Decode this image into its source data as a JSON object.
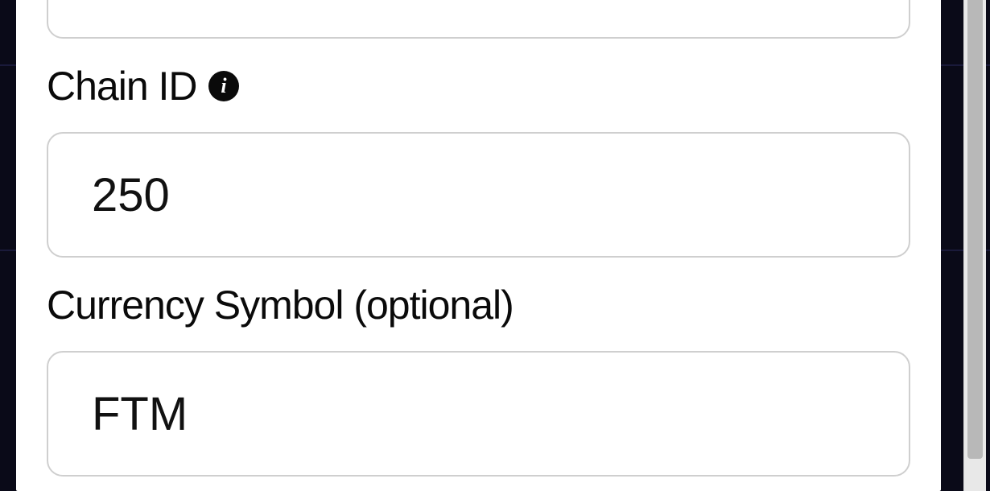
{
  "form": {
    "prev_field": {
      "value": ""
    },
    "chain_id": {
      "label": "Chain ID",
      "value": "250",
      "info_glyph": "i"
    },
    "currency_symbol": {
      "label": "Currency Symbol (optional)",
      "value": "FTM"
    }
  }
}
